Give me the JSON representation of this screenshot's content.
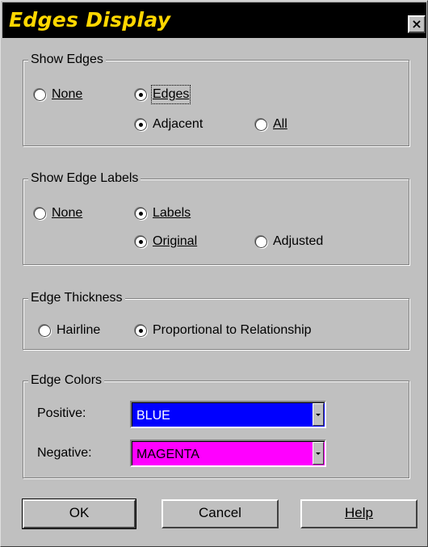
{
  "window": {
    "title": "Edges Display",
    "close_label": "×"
  },
  "show_edges": {
    "legend": "Show Edges",
    "none": "None",
    "edges": "Edges",
    "adjacent": "Adjacent",
    "all": "All",
    "selected": [
      "edges",
      "adjacent"
    ]
  },
  "show_edge_labels": {
    "legend": "Show Edge Labels",
    "none": "None",
    "labels": "Labels",
    "original": "Original",
    "adjusted": "Adjusted",
    "selected": [
      "labels",
      "original"
    ]
  },
  "edge_thickness": {
    "legend": "Edge Thickness",
    "hairline": "Hairline",
    "proportional": "Proportional to Relationship",
    "selected": "proportional"
  },
  "edge_colors": {
    "legend": "Edge Colors",
    "positive_label": "Positive:",
    "positive_value": "BLUE",
    "positive_color": "#0000ff",
    "negative_label": "Negative:",
    "negative_value": "MAGENTA",
    "negative_color": "#ff00ff"
  },
  "buttons": {
    "ok": "OK",
    "cancel": "Cancel",
    "help": "Help"
  }
}
